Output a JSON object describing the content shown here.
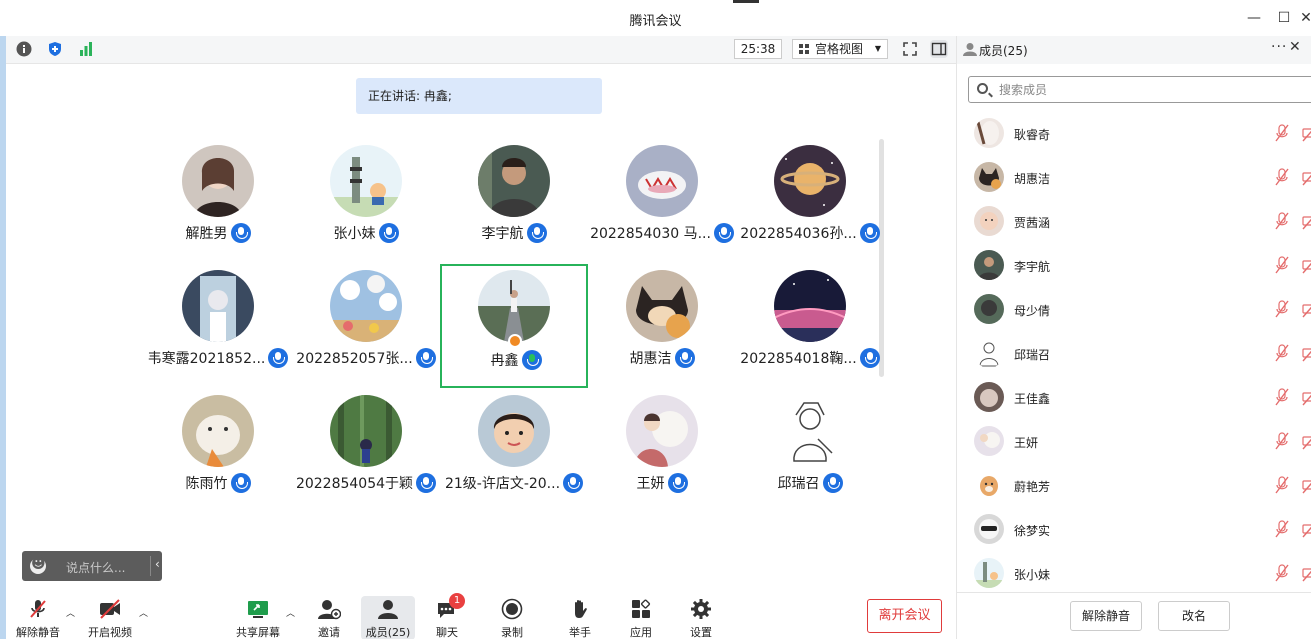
{
  "window": {
    "title": "腾讯会议"
  },
  "toolbar": {
    "timer": "25:38",
    "view_mode": "宫格视图"
  },
  "speaking_banner": "正在讲话: 冉鑫;",
  "participants": [
    {
      "name": "解胜男",
      "mic": "on"
    },
    {
      "name": "张小妹",
      "mic": "on"
    },
    {
      "name": "李宇航",
      "mic": "on"
    },
    {
      "name": "2022854030 马...",
      "mic": "on"
    },
    {
      "name": "2022854036孙...",
      "mic": "on"
    },
    {
      "name": "韦寒露2021852...",
      "mic": "on"
    },
    {
      "name": "2022852057张...",
      "mic": "on"
    },
    {
      "name": "冉鑫",
      "mic": "speaking",
      "active": true,
      "host": true
    },
    {
      "name": "胡惠洁",
      "mic": "on"
    },
    {
      "name": "2022854018鞠...",
      "mic": "on"
    },
    {
      "name": "陈雨竹",
      "mic": "on"
    },
    {
      "name": "2022854054于颖",
      "mic": "on"
    },
    {
      "name": "21级-许店文-20...",
      "mic": "on"
    },
    {
      "name": "王妍",
      "mic": "on"
    },
    {
      "name": "邱瑞召",
      "mic": "on"
    }
  ],
  "chat_input": {
    "placeholder": "说点什么..."
  },
  "bottombar": {
    "unmute": "解除静音",
    "video": "开启视频",
    "share": "共享屏幕",
    "invite": "邀请",
    "members": "成员(25)",
    "chat": "聊天",
    "chat_unread": "1",
    "record": "录制",
    "raise_hand": "举手",
    "apps": "应用",
    "settings": "设置",
    "leave": "离开会议"
  },
  "panel": {
    "title": "成员(25)",
    "search_placeholder": "搜索成员",
    "members": [
      {
        "name": "耿睿奇"
      },
      {
        "name": "胡惠洁"
      },
      {
        "name": "贾茜涵"
      },
      {
        "name": "李宇航"
      },
      {
        "name": "母少倩"
      },
      {
        "name": "邱瑞召"
      },
      {
        "name": "王佳鑫"
      },
      {
        "name": "王妍"
      },
      {
        "name": "蔚艳芳"
      },
      {
        "name": "徐梦实"
      },
      {
        "name": "张小妹"
      }
    ],
    "unmute_all": "解除静音",
    "rename": "改名"
  },
  "colors": {
    "accent_blue": "#1e6fe0",
    "speaking_green": "#27b35a",
    "leave_red": "#e03b3b",
    "banner_bg": "#dbe8fb"
  }
}
